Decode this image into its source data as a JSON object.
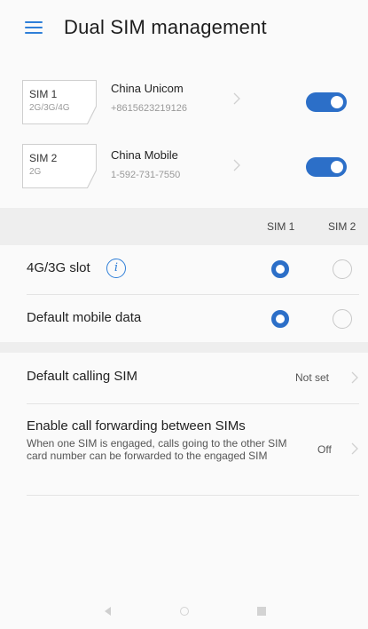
{
  "header": {
    "title": "Dual SIM management",
    "menu_icon": "hamburger-menu-icon"
  },
  "sims": [
    {
      "slot": "SIM 1",
      "types": "2G/3G/4G",
      "carrier": "China Unicom",
      "number": "+8615623219126",
      "enabled": true
    },
    {
      "slot": "SIM 2",
      "types": "2G",
      "carrier": "China Mobile",
      "number": "1-592-731-7550",
      "enabled": true
    }
  ],
  "columns": {
    "sim1": "SIM 1",
    "sim2": "SIM 2"
  },
  "slot_rows": [
    {
      "label": "4G/3G slot",
      "selected": "SIM 1",
      "has_info": true
    },
    {
      "label": "Default mobile data",
      "selected": "SIM 1",
      "has_info": false
    }
  ],
  "settings": [
    {
      "label": "Default calling SIM",
      "value": "Not set"
    },
    {
      "label": "Enable call forwarding between SIMs",
      "description": "When one SIM is engaged, calls going to the other SIM card number can be forwarded to the engaged SIM",
      "value": "Off"
    }
  ],
  "colors": {
    "accent": "#2c6fc8",
    "background": "#fafafa",
    "band": "#eeeeee"
  },
  "icons": {
    "info": "i",
    "chevron": "chevron-right-icon"
  }
}
